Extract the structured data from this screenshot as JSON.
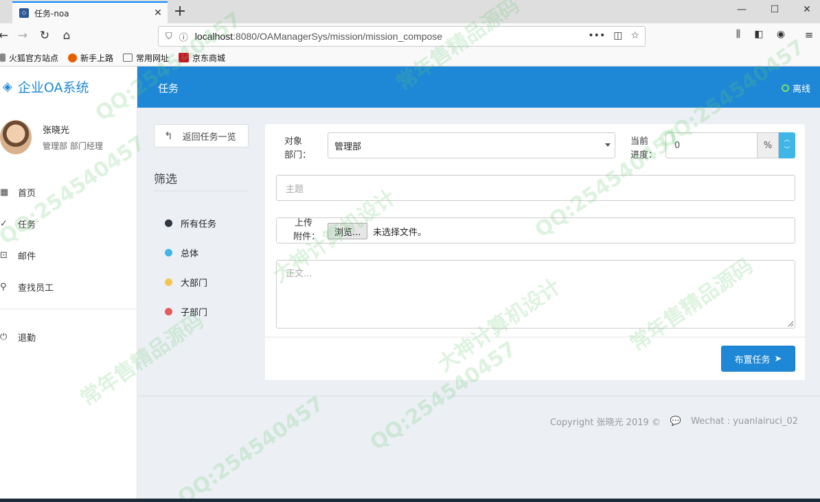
{
  "browser": {
    "tab_title": "任务-noa",
    "tab_close": "✕",
    "new_tab": "+",
    "url_host": "localhost",
    "url_path": ":8080/OAManagerSys/mission/mission_compose",
    "bookmarks": [
      "火狐官方站点",
      "新手上路",
      "常用网址",
      "京东商城"
    ]
  },
  "app": {
    "logo_text": "企业OA系统",
    "page_title": "任务",
    "status_label": "离线",
    "accent_color": "#1e88d6"
  },
  "user": {
    "name": "张晓光",
    "role": "管理部 部门经理"
  },
  "sidebar": {
    "items": [
      {
        "label": "首页",
        "icon": "dashboard-icon"
      },
      {
        "label": "任务",
        "icon": "check-icon"
      },
      {
        "label": "邮件",
        "icon": "inbox-icon"
      },
      {
        "label": "查找员工",
        "icon": "search-icon"
      }
    ],
    "logout_label": "退勤"
  },
  "filters": {
    "back_label": "返回任务一览",
    "title": "筛选",
    "items": [
      {
        "label": "所有任务",
        "color": "#2f3840"
      },
      {
        "label": "总体",
        "color": "#3fb6e7"
      },
      {
        "label": "大部门",
        "color": "#f3c74a"
      },
      {
        "label": "子部门",
        "color": "#e85b5b"
      }
    ]
  },
  "form": {
    "dept_label_1": "对象",
    "dept_label_2": "部门：",
    "dept_value": "管理部",
    "progress_label_1": "当前",
    "progress_label_2": "进度：",
    "progress_value": "0",
    "progress_unit": "%",
    "subject_placeholder": "主题",
    "upload_label_1": "上传",
    "upload_label_2": "附件：",
    "browse_label": "浏览...",
    "no_file_text": "未选择文件。",
    "body_placeholder": "正文...",
    "submit_label": "布置任务"
  },
  "footer": {
    "copyright": "Copyright 张晓光 2019 ©",
    "wechat": "Wechat : yuanlairuci_02"
  },
  "watermarks": [
    "QQ:254540457",
    "常年售精品源码",
    "大神计算机设计"
  ]
}
